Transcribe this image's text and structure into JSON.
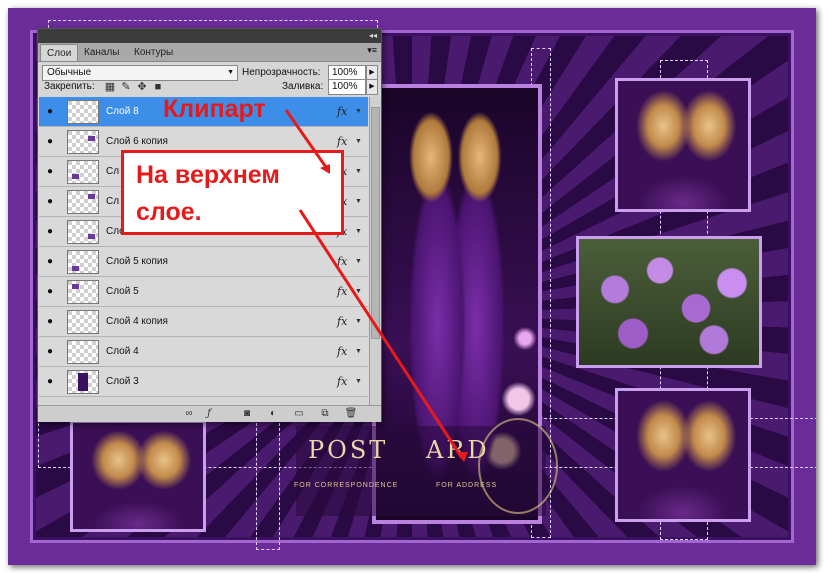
{
  "postcard": {
    "title_left": "POST",
    "title_right": "ARD",
    "caption_left": "FOR CORRESPONDENCE",
    "caption_right": "FOR ADDRESS"
  },
  "panel": {
    "tabs": [
      "Слои",
      "Каналы",
      "Контуры"
    ],
    "blend_mode": "Обычные",
    "opacity_label": "Непрозрачность:",
    "opacity_value": "100%",
    "lock_label": "Закрепить:",
    "fill_label": "Заливка:",
    "fill_value": "100%",
    "fx_label": "fx",
    "layers": [
      {
        "name": "Слой 8",
        "selected": true
      },
      {
        "name": "Слой 6 копия"
      },
      {
        "name": "Сл"
      },
      {
        "name": "Сл"
      },
      {
        "name": "Слой 5 копия"
      },
      {
        "name": "Слой 5 копия"
      },
      {
        "name": "Слой 5"
      },
      {
        "name": "Слой 4 копия"
      },
      {
        "name": "Слой 4"
      },
      {
        "name": "Слой 3"
      }
    ]
  },
  "annotations": {
    "heading": "Клипарт",
    "box_text": "На верхнем слое.",
    "color": "#e61a1a"
  }
}
